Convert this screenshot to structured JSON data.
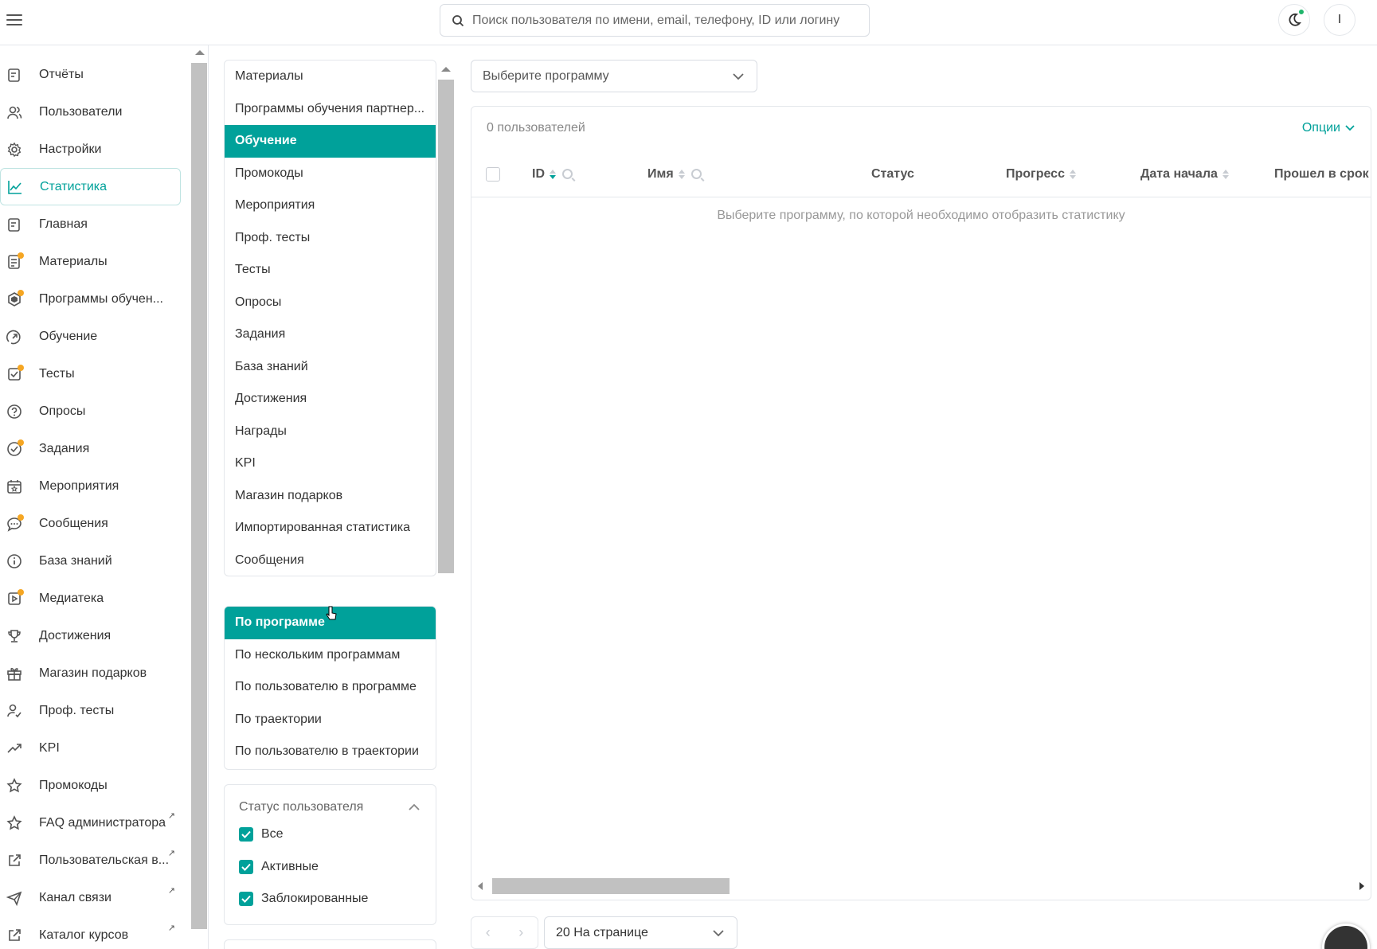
{
  "header": {
    "search_placeholder": "Поиск пользователя по имени, email, телефону, ID или логину",
    "avatar_letter": "I"
  },
  "sidebar": {
    "items": [
      {
        "label": "Отчёты",
        "icon": "report-icon",
        "dot": false,
        "external": false,
        "active": false
      },
      {
        "label": "Пользователи",
        "icon": "users-icon",
        "dot": false,
        "external": false,
        "active": false
      },
      {
        "label": "Настройки",
        "icon": "gear-icon",
        "dot": false,
        "external": false,
        "active": false
      },
      {
        "label": "Статистика",
        "icon": "chart-line-icon",
        "dot": false,
        "external": false,
        "active": true
      },
      {
        "label": "Главная",
        "icon": "home-icon",
        "dot": false,
        "external": false,
        "active": false
      },
      {
        "label": "Материалы",
        "icon": "document-icon",
        "dot": true,
        "external": false,
        "active": false
      },
      {
        "label": "Программы обучен...",
        "icon": "programs-icon",
        "dot": true,
        "external": false,
        "active": false
      },
      {
        "label": "Обучение",
        "icon": "learning-icon",
        "dot": false,
        "external": false,
        "active": false
      },
      {
        "label": "Тесты",
        "icon": "test-check-icon",
        "dot": true,
        "external": false,
        "active": false
      },
      {
        "label": "Опросы",
        "icon": "question-icon",
        "dot": false,
        "external": false,
        "active": false
      },
      {
        "label": "Задания",
        "icon": "task-check-icon",
        "dot": true,
        "external": false,
        "active": false
      },
      {
        "label": "Мероприятия",
        "icon": "calendar-star-icon",
        "dot": false,
        "external": false,
        "active": false
      },
      {
        "label": "Сообщения",
        "icon": "chat-icon",
        "dot": true,
        "external": false,
        "active": false
      },
      {
        "label": "База знаний",
        "icon": "info-icon",
        "dot": false,
        "external": false,
        "active": false
      },
      {
        "label": "Медиатека",
        "icon": "media-icon",
        "dot": true,
        "external": false,
        "active": false
      },
      {
        "label": "Достижения",
        "icon": "trophy-icon",
        "dot": false,
        "external": false,
        "active": false
      },
      {
        "label": "Магазин подарков",
        "icon": "gift-icon",
        "dot": false,
        "external": false,
        "active": false
      },
      {
        "label": "Проф. тесты",
        "icon": "user-check-icon",
        "dot": false,
        "external": false,
        "active": false
      },
      {
        "label": "KPI",
        "icon": "trend-up-icon",
        "dot": false,
        "external": false,
        "active": false
      },
      {
        "label": "Промокоды",
        "icon": "star-icon",
        "dot": false,
        "external": false,
        "active": false
      },
      {
        "label": "FAQ администратора",
        "icon": "star-icon",
        "dot": false,
        "external": true,
        "active": false
      },
      {
        "label": "Пользовательская в...",
        "icon": "external-link-icon",
        "dot": false,
        "external": true,
        "active": false
      },
      {
        "label": "Канал связи",
        "icon": "send-icon",
        "dot": false,
        "external": true,
        "active": false
      },
      {
        "label": "Каталог курсов",
        "icon": "external-link-icon",
        "dot": false,
        "external": true,
        "active": false
      }
    ]
  },
  "sections": {
    "items": [
      {
        "label": "Материалы",
        "active": false
      },
      {
        "label": "Программы обучения партнер...",
        "active": false
      },
      {
        "label": "Обучение",
        "active": true
      },
      {
        "label": "Промокоды",
        "active": false
      },
      {
        "label": "Мероприятия",
        "active": false
      },
      {
        "label": "Проф. тесты",
        "active": false
      },
      {
        "label": "Тесты",
        "active": false
      },
      {
        "label": "Опросы",
        "active": false
      },
      {
        "label": "Задания",
        "active": false
      },
      {
        "label": "База знаний",
        "active": false
      },
      {
        "label": "Достижения",
        "active": false
      },
      {
        "label": "Награды",
        "active": false
      },
      {
        "label": "KPI",
        "active": false
      },
      {
        "label": "Магазин подарков",
        "active": false
      },
      {
        "label": "Импортированная статистика",
        "active": false
      },
      {
        "label": "Сообщения",
        "active": false
      }
    ]
  },
  "report_types": {
    "items": [
      {
        "label": "По программе",
        "active": true
      },
      {
        "label": "По нескольким программам",
        "active": false
      },
      {
        "label": "По пользователю в программе",
        "active": false
      },
      {
        "label": "По траектории",
        "active": false
      },
      {
        "label": "По пользователю в траектории",
        "active": false
      }
    ]
  },
  "status_filter": {
    "title": "Статус пользователя",
    "options": [
      {
        "label": "Все",
        "checked": true
      },
      {
        "label": "Активные",
        "checked": true
      },
      {
        "label": "Заблокированные",
        "checked": true
      }
    ]
  },
  "program_select": {
    "placeholder": "Выберите программу"
  },
  "table": {
    "count": "0 пользователей",
    "options_label": "Опции",
    "columns": {
      "id": "ID",
      "name": "Имя",
      "status": "Статус",
      "progress": "Прогресс",
      "start_date": "Дата начала",
      "on_time": "Прошел в срок"
    },
    "empty_text": "Выберите программу, по которой необходимо отобразить статистику"
  },
  "pagination": {
    "per_page": "20 На странице"
  },
  "colors": {
    "accent": "#00a19a",
    "dot_orange": "#f5a623",
    "dot_green": "#1fb56a"
  }
}
